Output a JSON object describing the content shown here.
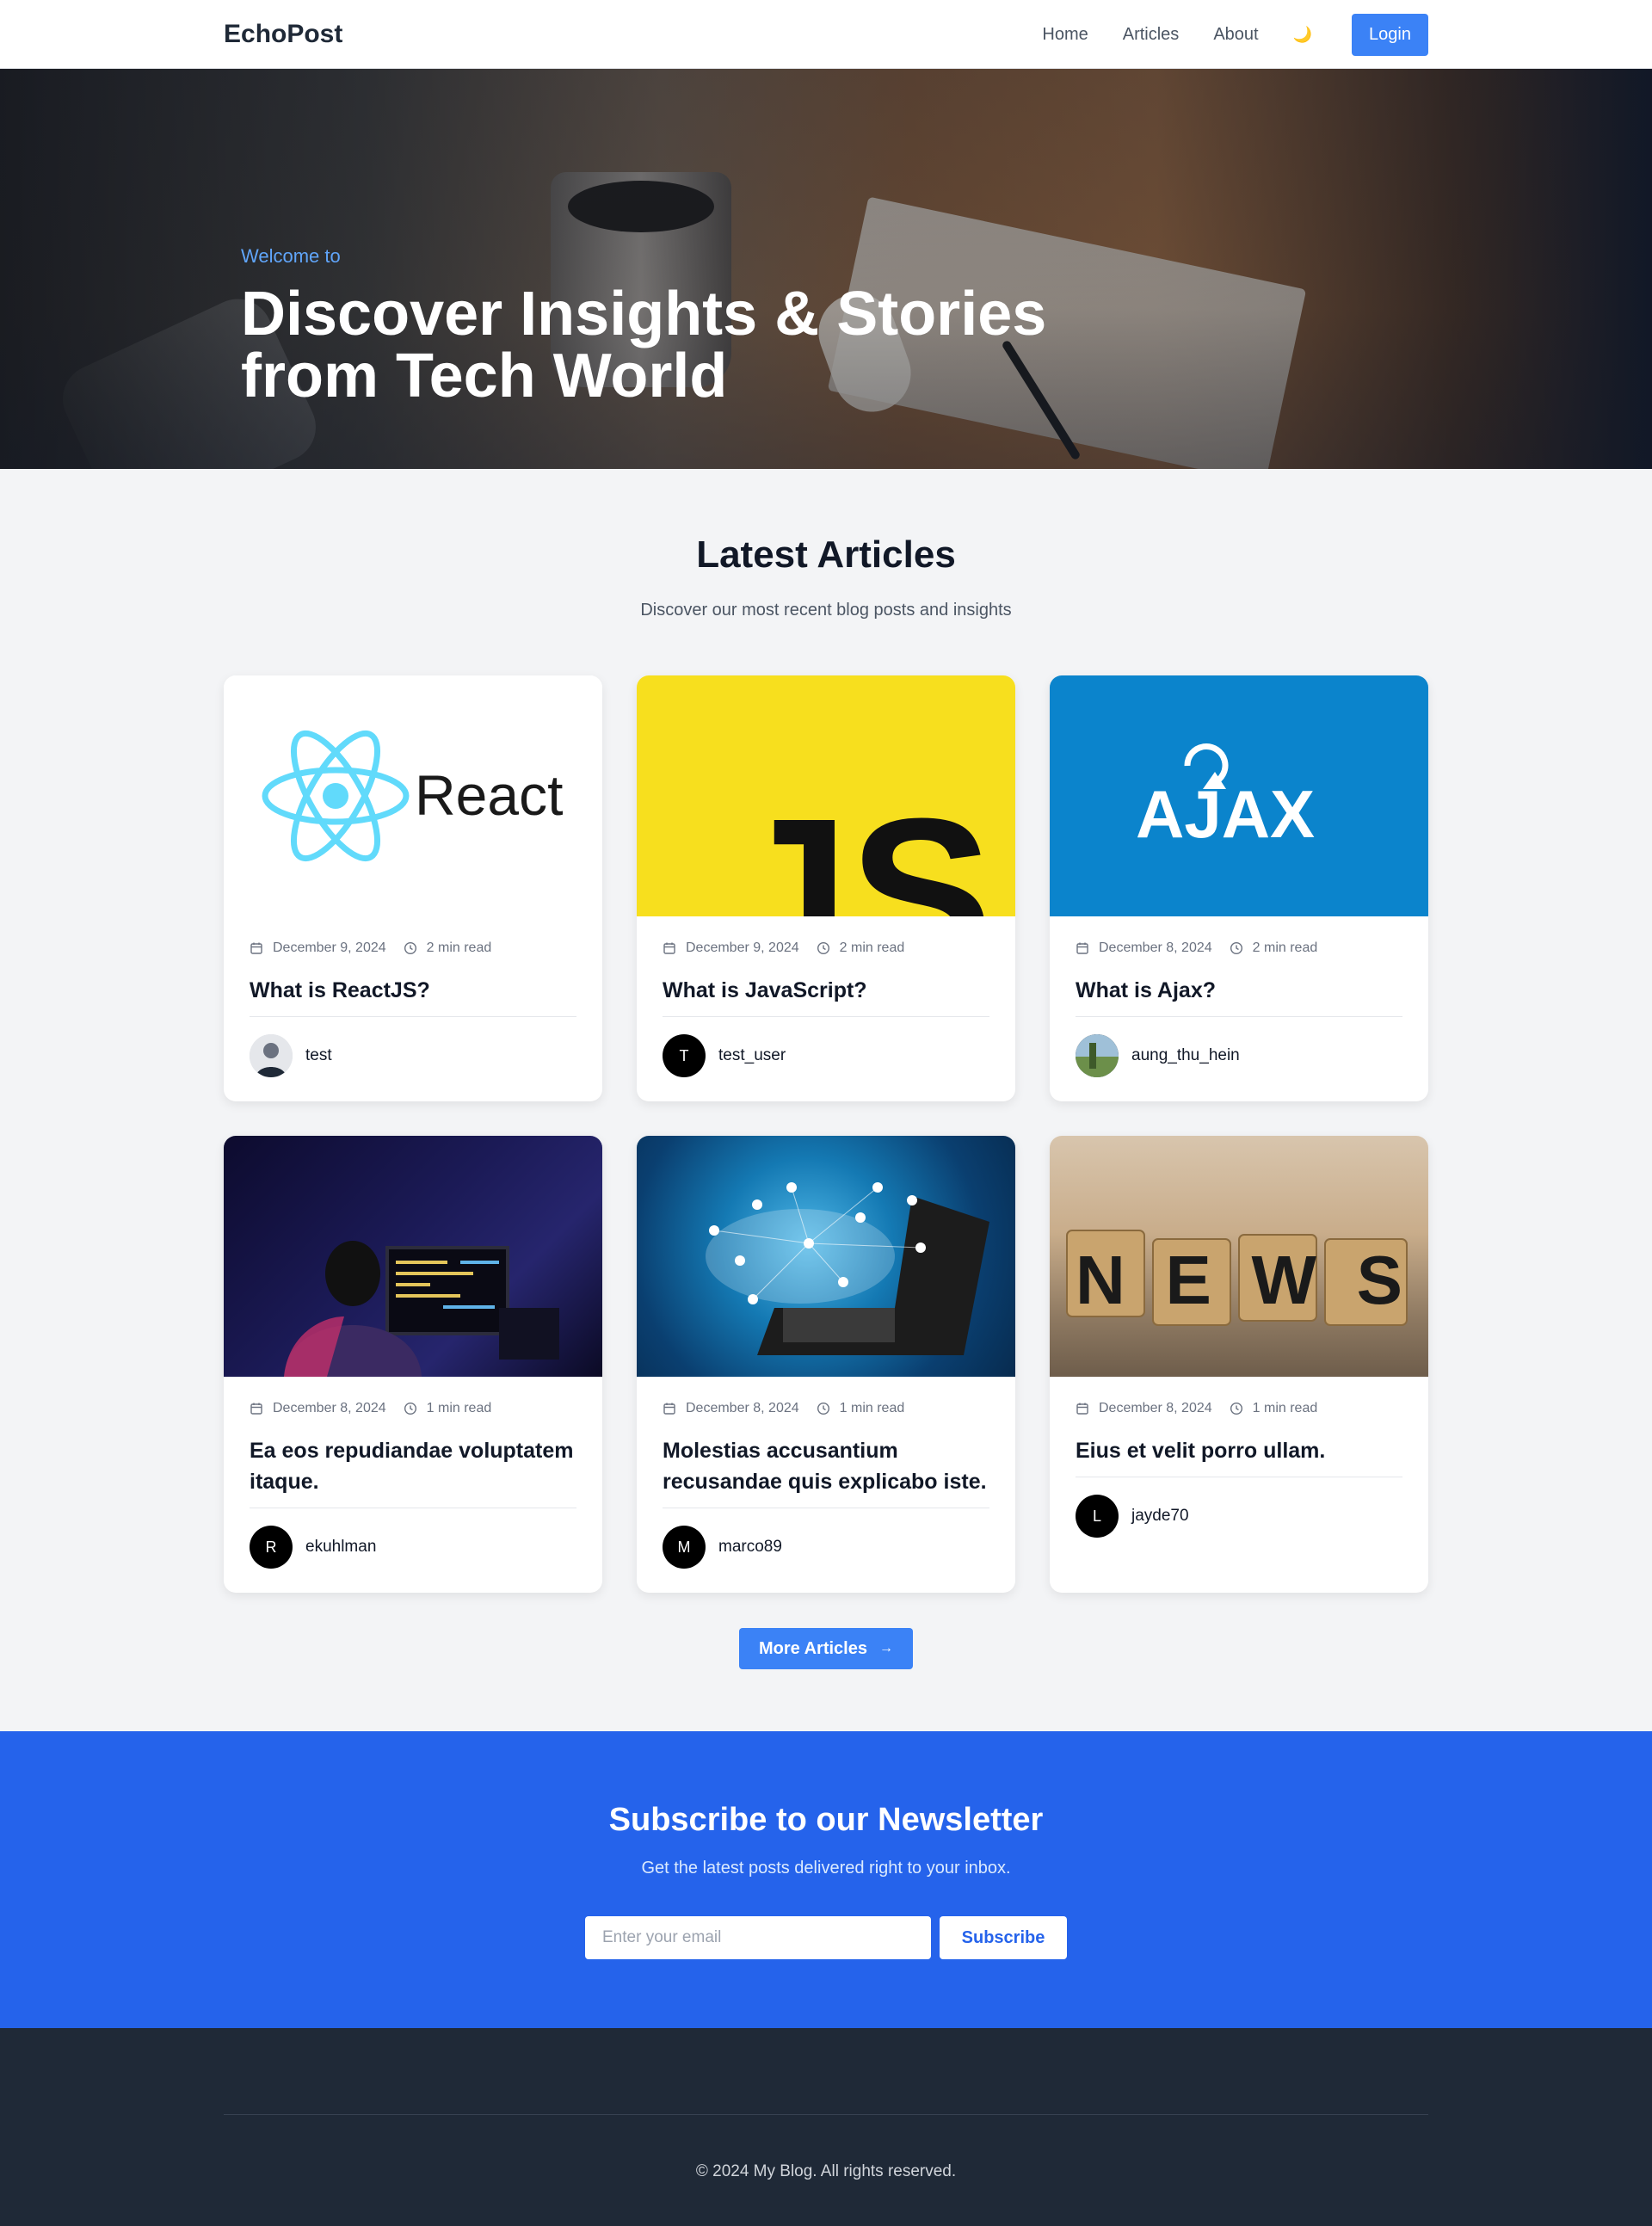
{
  "header": {
    "brand": "EchoPost",
    "nav": [
      "Home",
      "Articles",
      "About"
    ],
    "theme_icon": "moon-icon",
    "login_label": "Login"
  },
  "hero": {
    "kicker": "Welcome to",
    "title_line1": "Discover Insights & Stories",
    "title_line2": "from Tech World"
  },
  "latest": {
    "title": "Latest Articles",
    "subtitle": "Discover our most recent blog posts and insights"
  },
  "articles": [
    {
      "date": "December 9, 2024",
      "read": "2 min read",
      "title": "What is ReactJS?",
      "author": "test",
      "avatar_letter": "",
      "thumb_text": "React"
    },
    {
      "date": "December 9, 2024",
      "read": "2 min read",
      "title": "What is JavaScript?",
      "author": "test_user",
      "avatar_letter": "T",
      "thumb_text": "JS"
    },
    {
      "date": "December 8, 2024",
      "read": "2 min read",
      "title": "What is Ajax?",
      "author": "aung_thu_hein",
      "avatar_letter": "",
      "thumb_text": "AJAX"
    },
    {
      "date": "December 8, 2024",
      "read": "1 min read",
      "title": "Ea eos repudiandae voluptatem itaque.",
      "author": "ekuhlman",
      "avatar_letter": "R"
    },
    {
      "date": "December 8, 2024",
      "read": "1 min read",
      "title": "Molestias accusantium recusandae quis explicabo iste.",
      "author": "marco89",
      "avatar_letter": "M"
    },
    {
      "date": "December 8, 2024",
      "read": "1 min read",
      "title": "Eius et velit porro ullam.",
      "author": "jayde70",
      "avatar_letter": "L",
      "thumb_text": "NEWS"
    }
  ],
  "more_button": "More Articles",
  "newsletter": {
    "title": "Subscribe to our Newsletter",
    "subtitle": "Get the latest posts delivered right to your inbox.",
    "email_placeholder": "Enter your email",
    "button": "Subscribe"
  },
  "footer": {
    "copyright": "© 2024 My Blog. All rights reserved."
  },
  "colors": {
    "primary": "#3b82f6",
    "newsletter_bg": "#2563eb",
    "footer_bg": "#1f2937",
    "js_yellow": "#f7df1e",
    "ajax_blue": "#0b84cc",
    "react_cyan": "#61dafb"
  }
}
